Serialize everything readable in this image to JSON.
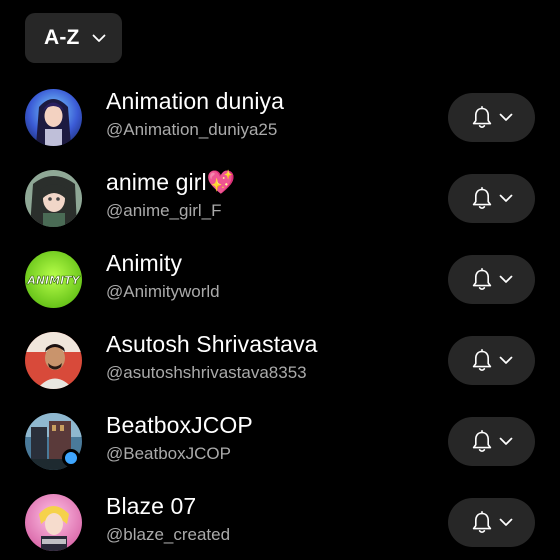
{
  "sort": {
    "label": "A-Z"
  },
  "subscriptions": [
    {
      "name": "Animation duniya",
      "handle": "@Animation_duniya25",
      "avatar_icon": "anime-girl-avatar",
      "avatar_color": "#3b5bd6"
    },
    {
      "name": "anime girl💖",
      "handle": "@anime_girl_F",
      "avatar_icon": "anime-character-avatar",
      "avatar_color": "#5a7a6a"
    },
    {
      "name": "Animity",
      "handle": "@Animityworld",
      "avatar_icon": "animity-logo-avatar",
      "avatar_color": "#7dd91e"
    },
    {
      "name": "Asutosh Shrivastava",
      "handle": "@asutoshshrivastava8353",
      "avatar_icon": "person-photo-avatar",
      "avatar_color": "#c83a3a"
    },
    {
      "name": "BeatboxJCOP",
      "handle": "@BeatboxJCOP",
      "avatar_icon": "building-photo-avatar",
      "avatar_color": "#2c5a78"
    },
    {
      "name": "Blaze 07",
      "handle": "@blaze_created",
      "avatar_icon": "anime-character-avatar",
      "avatar_color": "#e86fb0"
    }
  ],
  "icons": {
    "notification": "bell-icon",
    "dropdown": "chevron-down-icon"
  },
  "colors": {
    "background": "#000000",
    "button_bg": "#272727",
    "secondary_text": "#aaaaaa",
    "live_indicator": "#3ea6ff"
  }
}
